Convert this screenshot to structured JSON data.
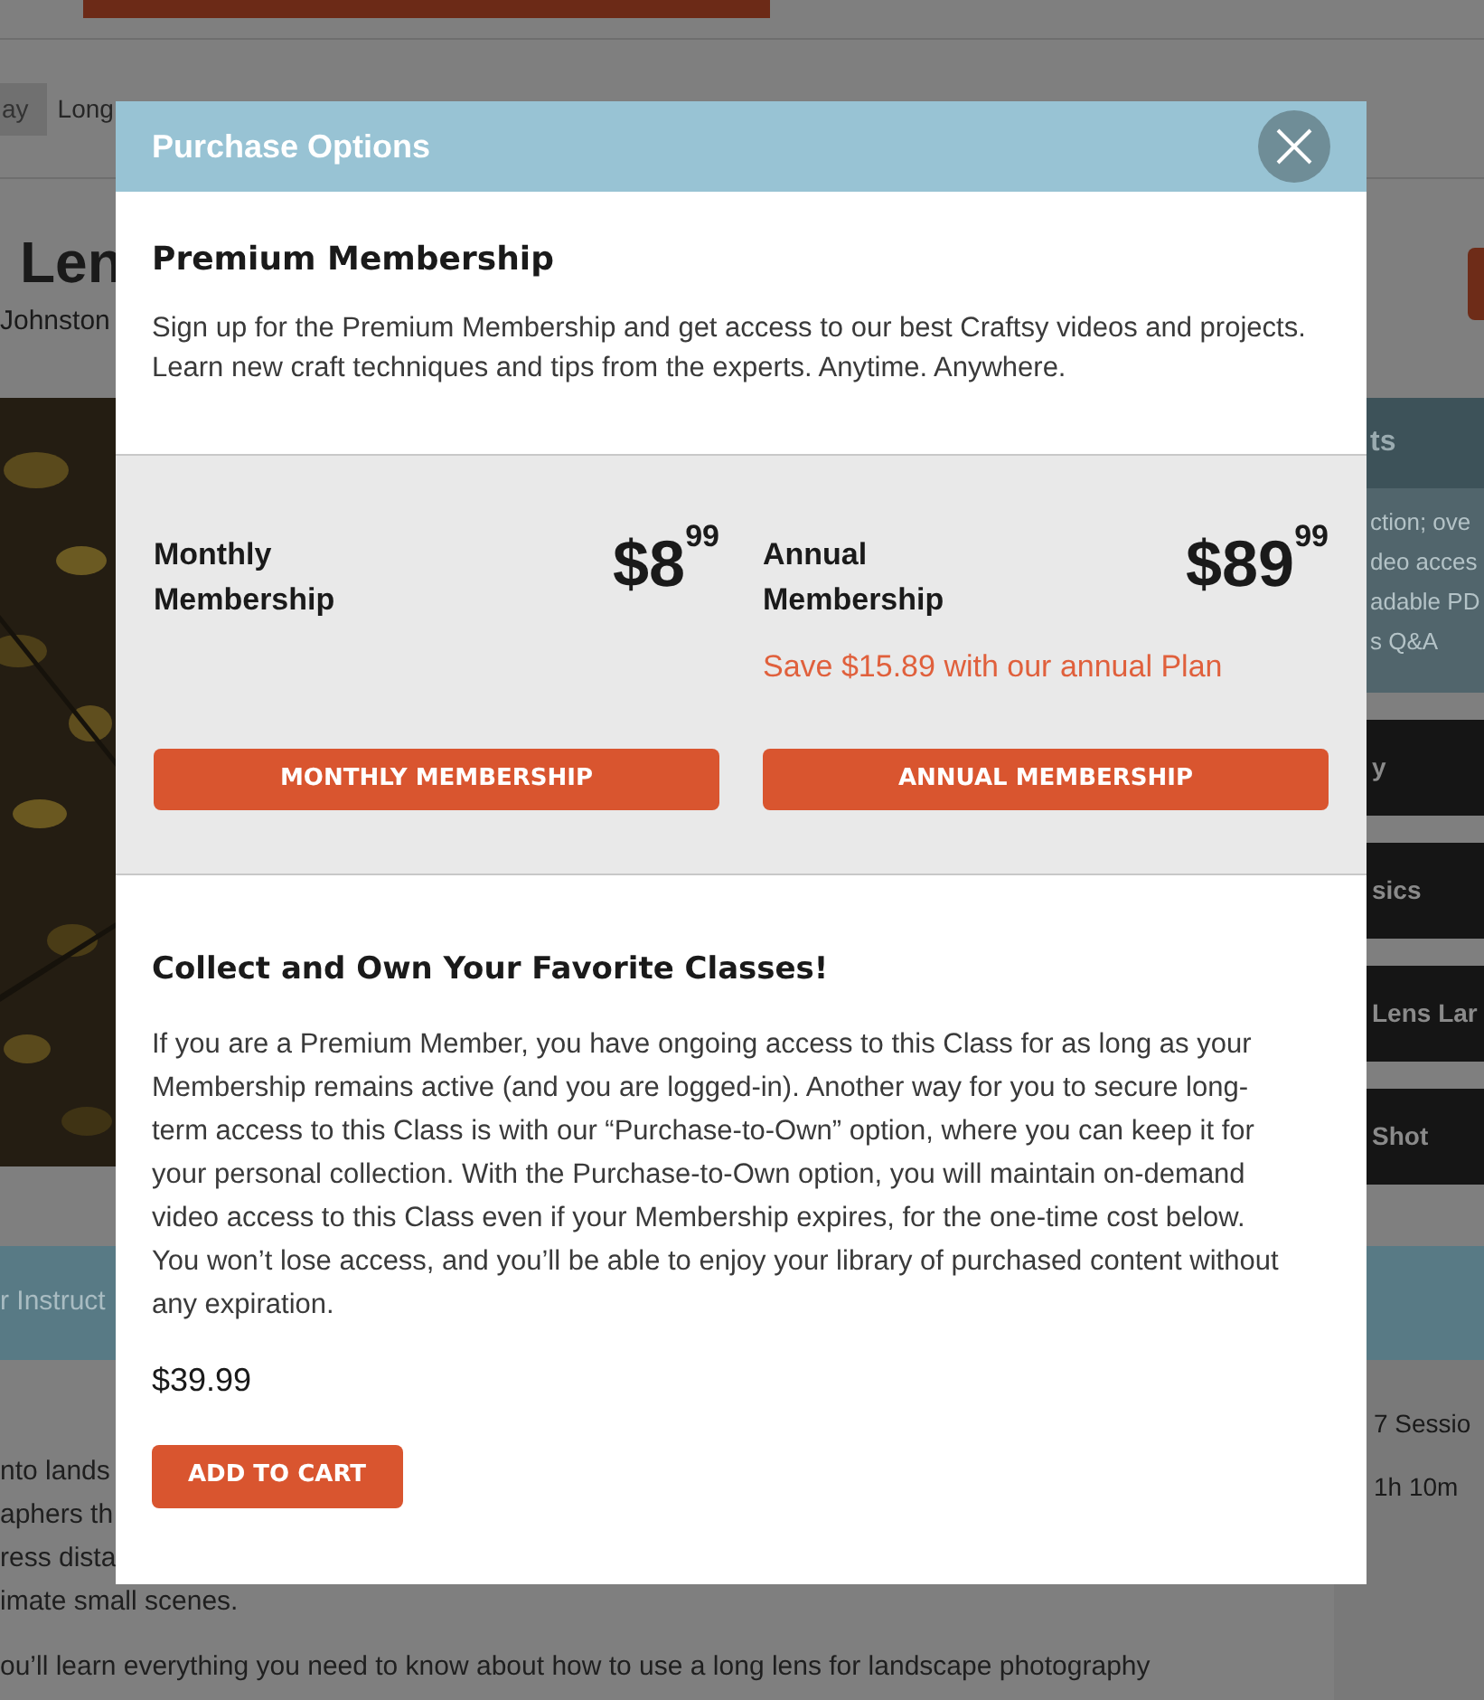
{
  "page": {
    "breadcrumb": [
      {
        "label": "ay"
      },
      {
        "label": "Long"
      }
    ],
    "title": "Len",
    "author": "Johnston",
    "sidebar": {
      "heading": "ts",
      "lines": [
        "ction; ove",
        "deo acces",
        "adable PD",
        "s Q&A"
      ],
      "buttons": [
        "y",
        "sics",
        "Lens Lar",
        "Shot"
      ]
    },
    "band_label": "r Instruct",
    "intro_lines": [
      "nto lands",
      "aphers th",
      "ress dista",
      "imate small scenes."
    ],
    "paragraph": "ou’ll learn everything you need to know about how to use a long lens for landscape photography",
    "facts": [
      "7 Sessio",
      "1h 10m"
    ]
  },
  "modal": {
    "title": "Purchase Options",
    "membership": {
      "heading": "Premium Membership",
      "text": "Sign up for the Premium Membership and get access to our best Craftsy videos and projects. Learn new craft techniques and tips from the experts. Anytime. Anywhere."
    },
    "plans": [
      {
        "name": "Monthly Membership",
        "dollars": "$8",
        "cents": "99",
        "button": "MONTHLY MEMBERSHIP"
      },
      {
        "name": "Annual Membership",
        "dollars": "$89",
        "cents": "99",
        "note": "Save $15.89 with our annual Plan",
        "button": "ANNUAL MEMBERSHIP"
      }
    ],
    "own": {
      "heading": "Collect and Own Your Favorite Classes!",
      "text": "If you are a Premium Member, you have ongoing access to this Class for as long as your Membership remains active (and you are logged-in). Another way for you to secure long-term access to this Class is with our “Purchase-to-Own” option, where you can keep it for your personal collection. With the Purchase-to-Own option, you will maintain on-demand video access to this Class even if your Membership expires, for the one-time cost below. You won’t lose access, and you’ll be able to enjoy your library of purchased content without any expiration.",
      "price": "$39.99",
      "button": "ADD TO CART"
    }
  }
}
